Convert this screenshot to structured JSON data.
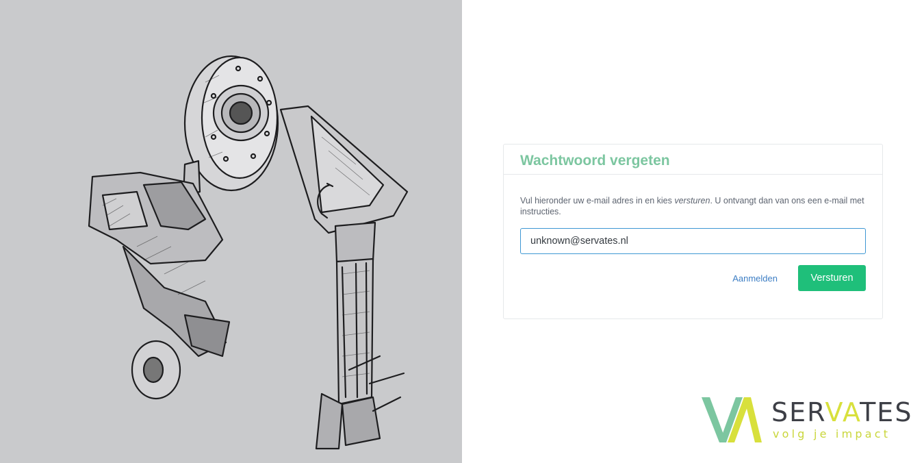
{
  "form": {
    "title": "Wachtwoord vergeten",
    "instructions_before": "Vul hieronder uw e-mail adres in en kies ",
    "instructions_emphasis": "versturen",
    "instructions_after": ". U ontvangt dan van ons een e-mail met instructies.",
    "email_value": "unknown@servates.nl",
    "login_link": "Aanmelden",
    "submit_label": "Versturen"
  },
  "brand": {
    "name_prefix": "SER",
    "name_v": "V",
    "name_a": "A",
    "name_suffix": "TES",
    "tagline": "volg je impact",
    "colors": {
      "primary_green": "#7cc6a0",
      "button_green": "#1fbf7a",
      "lime": "#d8e03c",
      "dark": "#3d3f46",
      "link_blue": "#3d7ec4"
    }
  },
  "illustration": {
    "icon": "robot-sketch-illustration"
  }
}
